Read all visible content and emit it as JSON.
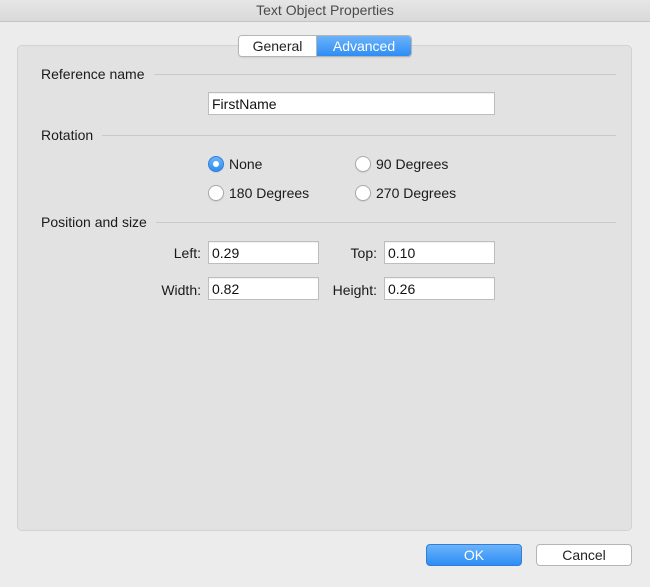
{
  "window": {
    "title": "Text Object Properties"
  },
  "tabs": [
    {
      "label": "General",
      "selected": false
    },
    {
      "label": "Advanced",
      "selected": true
    }
  ],
  "reference": {
    "heading": "Reference name",
    "value": "FirstName"
  },
  "rotation": {
    "heading": "Rotation",
    "options": [
      {
        "label": "None",
        "checked": true
      },
      {
        "label": "90 Degrees",
        "checked": false
      },
      {
        "label": "180 Degrees",
        "checked": false
      },
      {
        "label": "270 Degrees",
        "checked": false
      }
    ]
  },
  "position": {
    "heading": "Position and size",
    "left_label": "Left:",
    "left_value": "0.29",
    "top_label": "Top:",
    "top_value": "0.10",
    "width_label": "Width:",
    "width_value": "0.82",
    "height_label": "Height:",
    "height_value": "0.26"
  },
  "buttons": {
    "ok": "OK",
    "cancel": "Cancel"
  },
  "colors": {
    "accent": "#2d8df5",
    "panel": "#e2e2e2",
    "window": "#ececec"
  }
}
